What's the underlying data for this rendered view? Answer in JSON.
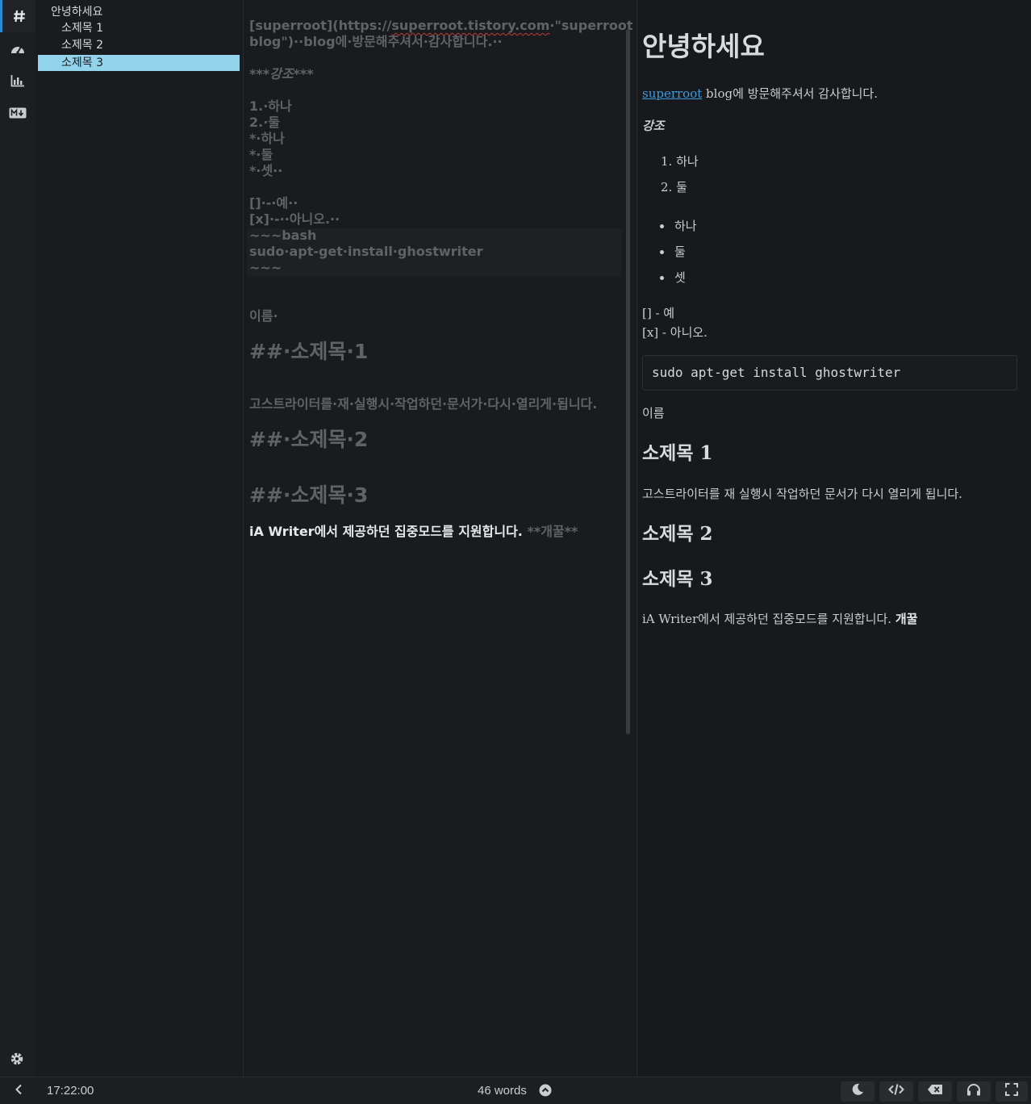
{
  "rail": {
    "icons": [
      "hash-icon",
      "speedometer-icon",
      "bar-chart-icon",
      "markdown-icon"
    ]
  },
  "outline": {
    "items": [
      {
        "label": "안녕하세요",
        "level": 1
      },
      {
        "label": "소제목 1",
        "level": 2
      },
      {
        "label": "소제목 2",
        "level": 2
      },
      {
        "label": "소제목 3",
        "level": 2,
        "selected": true
      }
    ]
  },
  "editor": {
    "lines": {
      "l1a": "[superroot](https://",
      "l1b": "superroot.tistory.com",
      "l1c": "·\"superroot",
      "l2": "blog\")··blog에·방문해주셔서·감사합니다.··",
      "l3": "***강조***",
      "l4": "1.·하나",
      "l5": "2.·둘",
      "l6": "*·하나",
      "l7": "*·둘",
      "l8": "*·셋··",
      "l9": "[]·-·예··",
      "l10": "[x]·-··아니오.··",
      "l11": "~~~bash",
      "l12": "sudo·apt-get·install·ghostwriter",
      "l13": "~~~",
      "l14": "이름·",
      "l15": "##·소제목·1",
      "l16": "고스트라이터를·재·실행시·작업하던·문서가·다시·열리게·됩니다.",
      "l17": "##·소제목·2",
      "l18": "##·소제목·3",
      "l19a": "iA Writer에서 제공하던 집중모드를 지원합니다. ",
      "l19b": "**개꿀**"
    }
  },
  "preview": {
    "h1": "안녕하세요",
    "p1_link": "superroot",
    "p1_text": " blog에 방문해주셔서 감사합니다.",
    "emphasis": "강조",
    "ordered": [
      "1. 하나",
      "2. 둘"
    ],
    "bullets": [
      "하나",
      "둘",
      "셋"
    ],
    "check1": "[] - 예",
    "check2": "[x] - 아니오.",
    "code": "sudo apt-get install ghostwriter",
    "name": "이름",
    "h2_1": "소제목 1",
    "p2": "고스트라이터를 재 실행시 작업하던 문서가 다시 열리게 됩니다.",
    "h2_2": "소제목 2",
    "h2_3": "소제목 3",
    "p3_text": "iA Writer에서 제공하던 집중모드를 지원합니다. ",
    "p3_bold": "개꿀"
  },
  "statusbar": {
    "time": "17:22:00",
    "words": "46 words",
    "buttons": [
      "moon-icon",
      "code-icon",
      "backspace-icon",
      "headphones-icon",
      "fullscreen-icon"
    ]
  },
  "colors": {
    "accent": "#2d8ad6",
    "selection": "#94d3ec",
    "link": "#3d9be0",
    "spellcheck": "#c23b3b"
  }
}
